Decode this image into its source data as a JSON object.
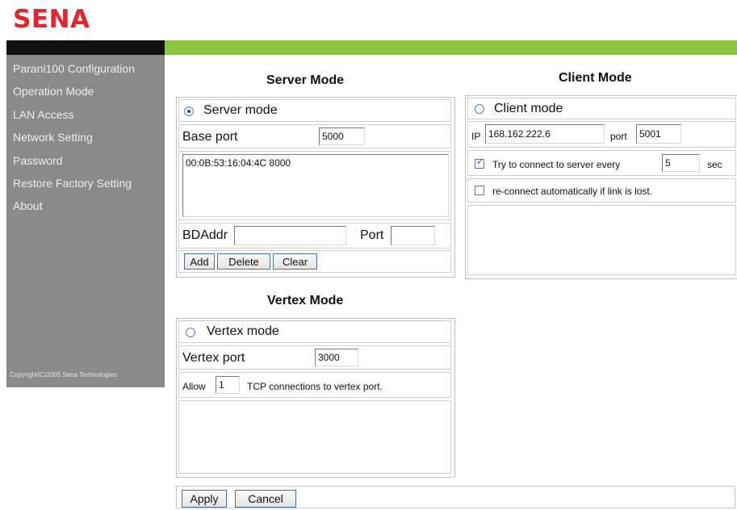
{
  "brand": {
    "logo": "SENA"
  },
  "sidebar": {
    "items": [
      {
        "label": "Parani100 Configuration"
      },
      {
        "label": "Operation Mode"
      },
      {
        "label": "LAN Access"
      },
      {
        "label": "Network Setting"
      },
      {
        "label": "Password"
      },
      {
        "label": "Restore Factory Setting"
      },
      {
        "label": "About"
      }
    ],
    "copyright": "Copyright(C)2005 Sena Technologies"
  },
  "server": {
    "title": "Server Mode",
    "radio_label": "Server mode",
    "radio_selected": true,
    "base_port_label": "Base port",
    "base_port_value": "5000",
    "list_value": "00:0B:53:16:04:4C 8000",
    "bdaddr_label": "BDAddr",
    "bdaddr_value": "",
    "port_label": "Port",
    "port_value": "",
    "add_label": "Add",
    "delete_label": "Delete",
    "clear_label": "Clear"
  },
  "client": {
    "title": "Client Mode",
    "radio_label": "Client mode",
    "radio_selected": false,
    "ip_label": "IP",
    "ip_value": "168.162.222.6",
    "port_label": "port",
    "port_value": "5001",
    "retry_prefix": "Try to connect to server every",
    "retry_value": "5",
    "retry_suffix": "sec",
    "retry_checked": true,
    "reconnect_label": "re-connect automatically if link is lost.",
    "reconnect_checked": false
  },
  "vertex": {
    "title": "Vertex Mode",
    "radio_label": "Vertex mode",
    "radio_selected": false,
    "port_label": "Vertex port",
    "port_value": "3000",
    "allow_prefix": "Allow",
    "allow_value": "1",
    "allow_suffix": "TCP connections to vertex port."
  },
  "footer": {
    "apply_label": "Apply",
    "cancel_label": "Cancel"
  }
}
